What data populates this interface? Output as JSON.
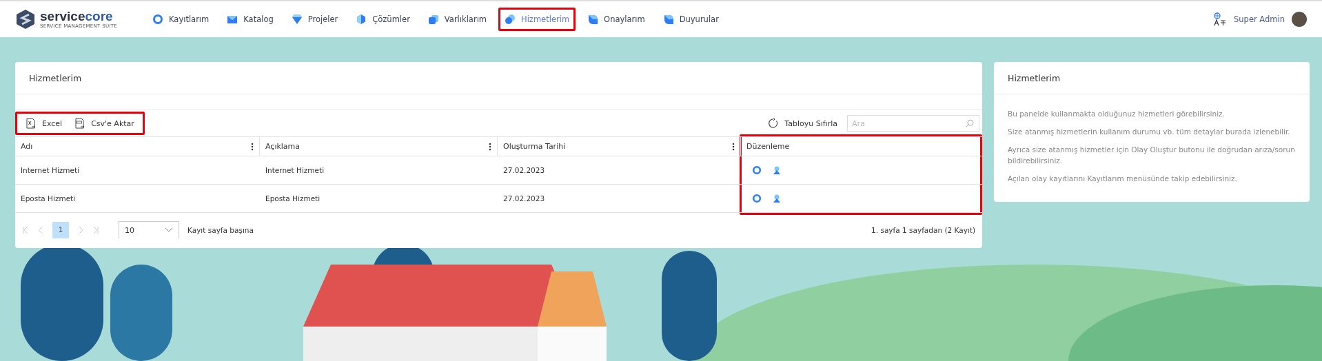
{
  "brand": {
    "name_part_1": "service",
    "name_part_2": "core",
    "tagline": "SERVICE MANAGEMENT SUITE"
  },
  "nav": [
    {
      "label": "Kayıtlarım",
      "kind": "ring",
      "selected": false
    },
    {
      "label": "Katalog",
      "kind": "envelope",
      "selected": false
    },
    {
      "label": "Projeler",
      "kind": "diamond",
      "selected": false
    },
    {
      "label": "Çözümler",
      "kind": "hexagon",
      "selected": false
    },
    {
      "label": "Varlıklarım",
      "kind": "squares",
      "selected": false
    },
    {
      "label": "Hizmetlerim",
      "kind": "circles",
      "selected": true
    },
    {
      "label": "Onaylarım",
      "kind": "leaf",
      "selected": false
    },
    {
      "label": "Duyurular",
      "kind": "leaf",
      "selected": false
    }
  ],
  "user": {
    "name": "Super Admin"
  },
  "main_card": {
    "title": "Hizmetlerim",
    "toolbar": {
      "highlighted": true,
      "buttons": [
        {
          "label": "Excel",
          "kind": "excel"
        },
        {
          "label": "Csv'e Aktar",
          "kind": "csv"
        }
      ]
    },
    "reset_button": "Tabloyu Sıfırla",
    "search": {
      "placeholder": "Ara"
    },
    "table": {
      "columns": [
        {
          "label": "Adı",
          "menu": true,
          "highlighted": false
        },
        {
          "label": "Açıklama",
          "menu": true,
          "highlighted": false
        },
        {
          "label": "Oluşturma Tarihi",
          "menu": true,
          "highlighted": false
        },
        {
          "label": "Düzenleme",
          "menu": false,
          "highlighted": true
        }
      ],
      "rows": [
        {
          "cells": [
            "Internet Hizmeti",
            "Internet Hizmeti",
            "27.02.2023"
          ]
        },
        {
          "cells": [
            "Eposta Hizmeti",
            "Eposta Hizmeti",
            "27.02.2023"
          ]
        }
      ]
    },
    "pagination": {
      "pages": [
        {
          "label": "1",
          "selected": true
        }
      ],
      "page_size": "10",
      "page_size_label": "Kayıt sayfa başına",
      "summary": "1. sayfa 1 sayfadan (2 Kayıt)"
    }
  },
  "info_card": {
    "title": "Hizmetlerim",
    "paragraphs": [
      "Bu panelde kullanmakta olduğunuz hizmetleri görebilirsiniz.",
      "Size atanmış hizmetlerin kullanım durumu vb. tüm detaylar burada izlenebilir.",
      "Ayrıca size atanmış hizmetler için Olay Oluştur butonu ile doğrudan arıza/sorun bildirebilirsiniz.",
      "Açılan olay kayıtlarını Kayıtlarım menüsünde takip edebilirsiniz."
    ]
  }
}
